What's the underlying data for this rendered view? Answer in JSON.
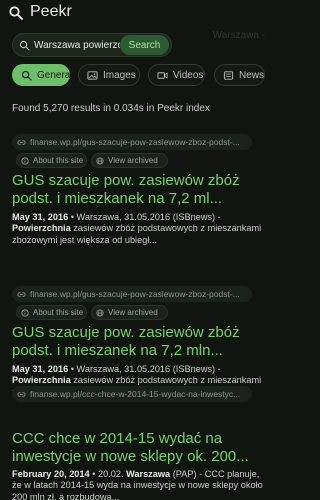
{
  "app": {
    "title": "Peekr"
  },
  "search": {
    "value": "Warszawa powierzch",
    "button_label": "Search"
  },
  "ghost_text": "Warszawa -",
  "tabs": [
    {
      "label": "General",
      "icon": "search-icon",
      "active": true
    },
    {
      "label": "Images",
      "icon": "image-icon",
      "active": false
    },
    {
      "label": "Videos",
      "icon": "video-icon",
      "active": false
    },
    {
      "label": "News",
      "icon": "news-icon",
      "active": false
    }
  ],
  "results_count": "Found 5,270 results in 0.034s in Peekr index",
  "chips": {
    "about": "About this site",
    "archive": "View archived"
  },
  "results": [
    {
      "url": "finanse.wp.pl/gus-szacuje-pow-zasiewow-zboz-podst-...",
      "title": "GUS szacuje pow. zasiewów zbóż podst. i mieszkanek na 7,2 ml...",
      "date": "May 31, 2016",
      "snippet_lead": " • Warszawa, 31.05.2016 (ISBnews) - ",
      "snippet_bold": "Powierzchnia",
      "snippet_rest": " zasiewów zbóż podstawowych z mieszankami zbożowymi jest większa od ubiegł..."
    },
    {
      "url": "finanse.wp.pl/gus-szacuje-pow-zasiewow-zboz-podst-...",
      "title": "GUS szacuje pow. zasiewów zbóż podst. i mieszanek na 7,2 mln...",
      "date": "May 31, 2016",
      "snippet_lead": " • Warszawa, 31.05.2016 (ISBnews) - ",
      "snippet_bold": "Powierzchnia",
      "snippet_rest": " zasiewów zbóż podstawowych z mieszankami zbożowymi jest większa od ubiegł..."
    },
    {
      "url": "finanse.wp.pl/ccc-chce-w-2014-15-wydac-na-inwestyc...",
      "title": "CCC chce w 2014-15 wydać na inwestycje w nowe sklepy ok. 200...",
      "date": "February 20, 2014",
      "snippet_lead": " • 20.02. ",
      "snippet_bold": "Warszawa",
      "snippet_rest": " (PAP) - CCC planuje, że w latach 2014-15 wyda na inwestycje w nowe sklepy około 200 mln zł, a rozbudowa..."
    }
  ]
}
